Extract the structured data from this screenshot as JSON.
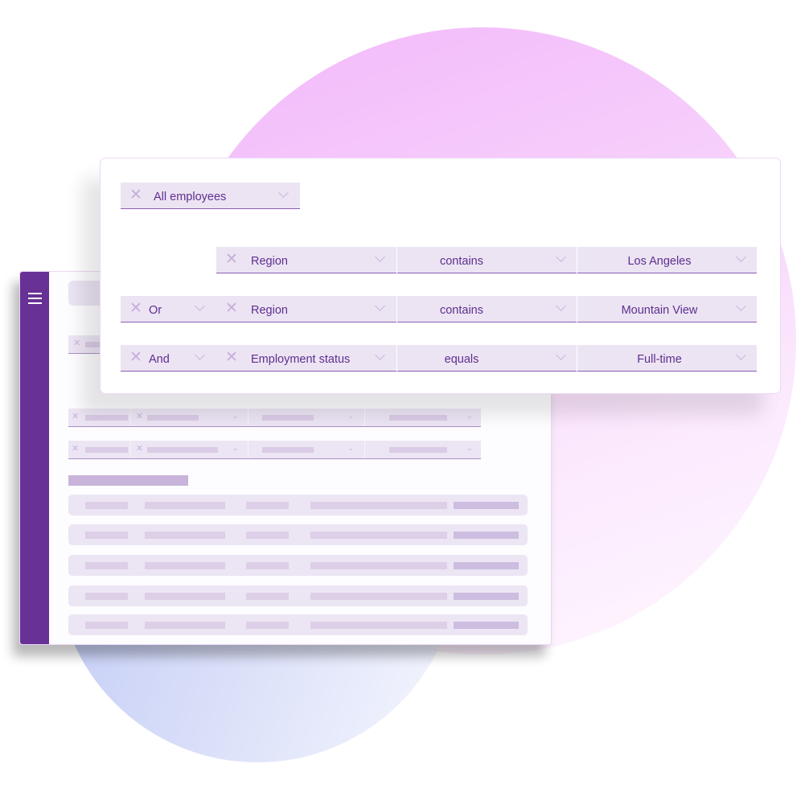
{
  "colors": {
    "brand_purple": "#673196",
    "field_bg": "#ece4f3",
    "field_text": "#5e2e8e",
    "field_underline": "#8a5eb3"
  },
  "filter_card": {
    "scope": {
      "label": "All employees",
      "remove_icon": "close-icon",
      "dropdown_icon": "chevron-down-icon"
    },
    "rules": [
      {
        "connector": null,
        "field": "Region",
        "operator": "contains",
        "value": "Los Angeles"
      },
      {
        "connector": "Or",
        "field": "Region",
        "operator": "contains",
        "value": "Mountain View"
      },
      {
        "connector": "And",
        "field": "Employment status",
        "operator": "equals",
        "value": "Full-time"
      }
    ]
  },
  "background_app": {
    "sidebar_icon": "hamburger-menu-icon",
    "skeleton_filter_rows": 3,
    "skeleton_table_rows": 5
  }
}
